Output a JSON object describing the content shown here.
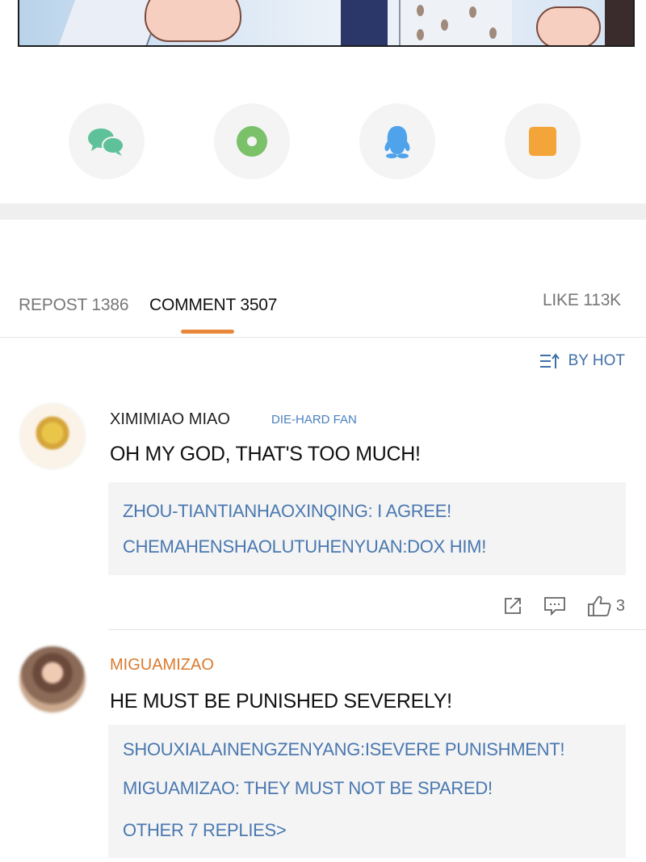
{
  "share_buttons": [
    {
      "icon": "chat-bubbles-icon",
      "color": "#5fc19a"
    },
    {
      "icon": "moments-circle-icon",
      "color": "#7ac16a"
    },
    {
      "icon": "penguin-icon",
      "color": "#4ea3ea"
    },
    {
      "icon": "square-icon",
      "color": "#f3a53a"
    }
  ],
  "tabs": {
    "repost": "REPOST 1386",
    "comment": "COMMENT 3507",
    "like": "LIKE 113K"
  },
  "sort_label": "BY HOT",
  "comments": [
    {
      "username": "XIMIMIAO MIAO",
      "badge": "DIE-HARD FAN",
      "text": "OH MY GOD, THAT'S TOO MUCH!",
      "replies": [
        "ZHOU-TIANTIANHAOXINQING: I AGREE!",
        "CHEMAHENSHAOLUTUHENYUAN:DOX HIM!"
      ],
      "like_count": "3"
    },
    {
      "username": "MIGUAMIZAO",
      "text": "HE MUST BE PUNISHED SEVERELY!",
      "replies": [
        "SHOUXIALAINENGZENYANG:ISEVERE PUNISHMENT!",
        "MIGUAMIZAO: THEY MUST NOT BE SPARED!"
      ],
      "more_replies": "OTHER 7 REPLIES>"
    }
  ],
  "colors": {
    "accent": "#e8873a",
    "link_blue": "#4a78b0",
    "username_orange": "#d97a2f"
  }
}
